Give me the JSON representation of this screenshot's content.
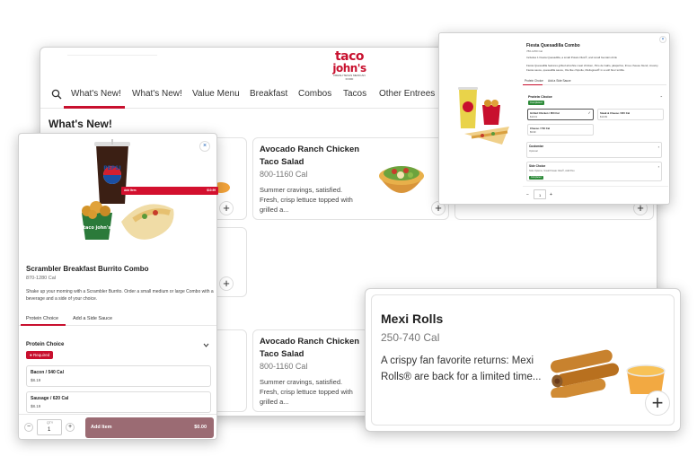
{
  "brand": {
    "logo_line1": "taco",
    "logo_line2": "john's",
    "logo_tagline": "FRESH TEXAS MEXICAN FOOD"
  },
  "nav": {
    "tabs": [
      "What's New!",
      "What's New!",
      "Value Menu",
      "Breakfast",
      "Combos",
      "Tacos",
      "Other Entrees"
    ]
  },
  "main": {
    "section_title": "What's New!",
    "cards": [
      {
        "name": "Avocado Ranch Chicken Taco Salad",
        "cal": "800-1160 Cal",
        "desc": "Summer cravings, satisfied. Fresh, crisp lettuce topped with grilled a..."
      },
      {
        "name": "Avocado Ranch Chicken Taco Salad",
        "cal": "800-1160 Cal",
        "desc": "Summer cravings, satisfied. Fresh, crisp lettuce topped with grilled a..."
      }
    ],
    "add_symbol": "+"
  },
  "burrito_modal": {
    "close_symbol": "×",
    "title": "Scrambler Breakfast Burrito Combo",
    "cal": "870-1280 Cal",
    "desc": "Shake up your morning with a Scrambler Burrito. Order a small medium or large Combo with a beverage and a side of your choice.",
    "tabs": [
      "Protein Choice",
      "Add a Side Sauce"
    ],
    "section": "Protein Choice",
    "required_badge": "Required",
    "options": [
      {
        "name": "Bacon / 540 Cal",
        "price": "$8.19"
      },
      {
        "name": "Sausage / 620 Cal",
        "price": "$8.19"
      }
    ],
    "qty_label": "QTY",
    "qty_value": "1",
    "add_label": "Add Item",
    "add_price": "$0.00",
    "cup_label": "PEPSI",
    "bucket_label": "taco john's"
  },
  "quesadilla_modal": {
    "close_symbol": "×",
    "title": "Fiesta Quesadilla Combo",
    "cal": "780-1250 Cal",
    "subtitle": "Includes 1 Fiesta Quesadilla, a small Potato Olés®, and small fountain drink",
    "desc": "Fiesta Quesadilla features grilled all-white meat chicken, Pico de Gallo, jalapeños, three cheese blend, creamy Fiesta sauce, quesadilla sauce, Ole like chipotle, Meltsgreat® in a soft flour tortilla.",
    "tabs": [
      "Protein Choice",
      "Add a Side Sauce"
    ],
    "section": "Protein Choice",
    "complete_badge": "Completed",
    "options": [
      {
        "name": "Grilled Chicken / 850 Cal",
        "price": "$10.19"
      },
      {
        "name": "Steak & Cheese / 815 Cal",
        "price": "$10.99"
      },
      {
        "name": "Cheese / 740 Cal",
        "price": "$9.99"
      }
    ],
    "rows": [
      {
        "name": "Customize",
        "sub": "Optional"
      },
      {
        "name": "Side Choice",
        "sub": "Side Options, Small Potato Olés®, Add Pico"
      }
    ],
    "qty_value": "1",
    "add_label": "Add Item",
    "add_price": "$10.99"
  },
  "mexi_card": {
    "name": "Mexi Rolls",
    "cal": "250-740 Cal",
    "desc": "A crispy fan favorite returns: Mexi Rolls® are back for a limited time...",
    "add_symbol": "+"
  },
  "colors": {
    "brand_red": "#c8102e",
    "add_button_muted": "#9b6b73",
    "complete_green": "#2e8b3a"
  }
}
